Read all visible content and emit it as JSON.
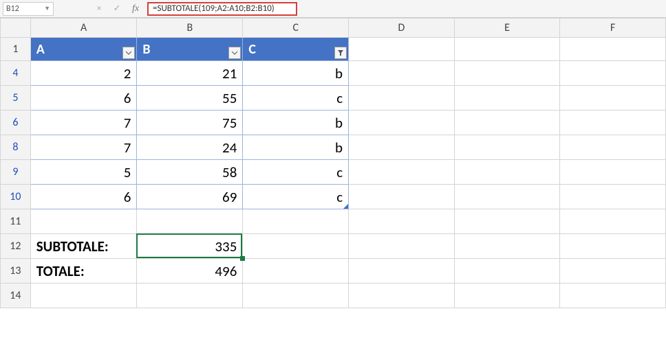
{
  "formula_bar": {
    "cell_ref": "B12",
    "cancel_icon": "×",
    "confirm_icon": "✓",
    "fx_label": "fx",
    "formula": "=SUBTOTALE(109;A2:A10;B2:B10)"
  },
  "columns": [
    "A",
    "B",
    "C",
    "D",
    "E",
    "F"
  ],
  "row_numbers": [
    "1",
    "4",
    "5",
    "6",
    "8",
    "9",
    "10",
    "11",
    "12",
    "13",
    "14"
  ],
  "filtered_rows": [
    "4",
    "5",
    "6",
    "8",
    "9",
    "10"
  ],
  "table_header": {
    "A": "A",
    "B": "B",
    "C": "C"
  },
  "rows": [
    {
      "A": "2",
      "B": "21",
      "C": "b"
    },
    {
      "A": "6",
      "B": "55",
      "C": "c"
    },
    {
      "A": "7",
      "B": "75",
      "C": "b"
    },
    {
      "A": "7",
      "B": "24",
      "C": "b"
    },
    {
      "A": "5",
      "B": "58",
      "C": "c"
    },
    {
      "A": "6",
      "B": "69",
      "C": "c"
    }
  ],
  "summary": {
    "subtotale_label": "SUBTOTALE:",
    "subtotale_value": "335",
    "totale_label": "TOTALE:",
    "totale_value": "496"
  },
  "cols_hdr_active": "B"
}
